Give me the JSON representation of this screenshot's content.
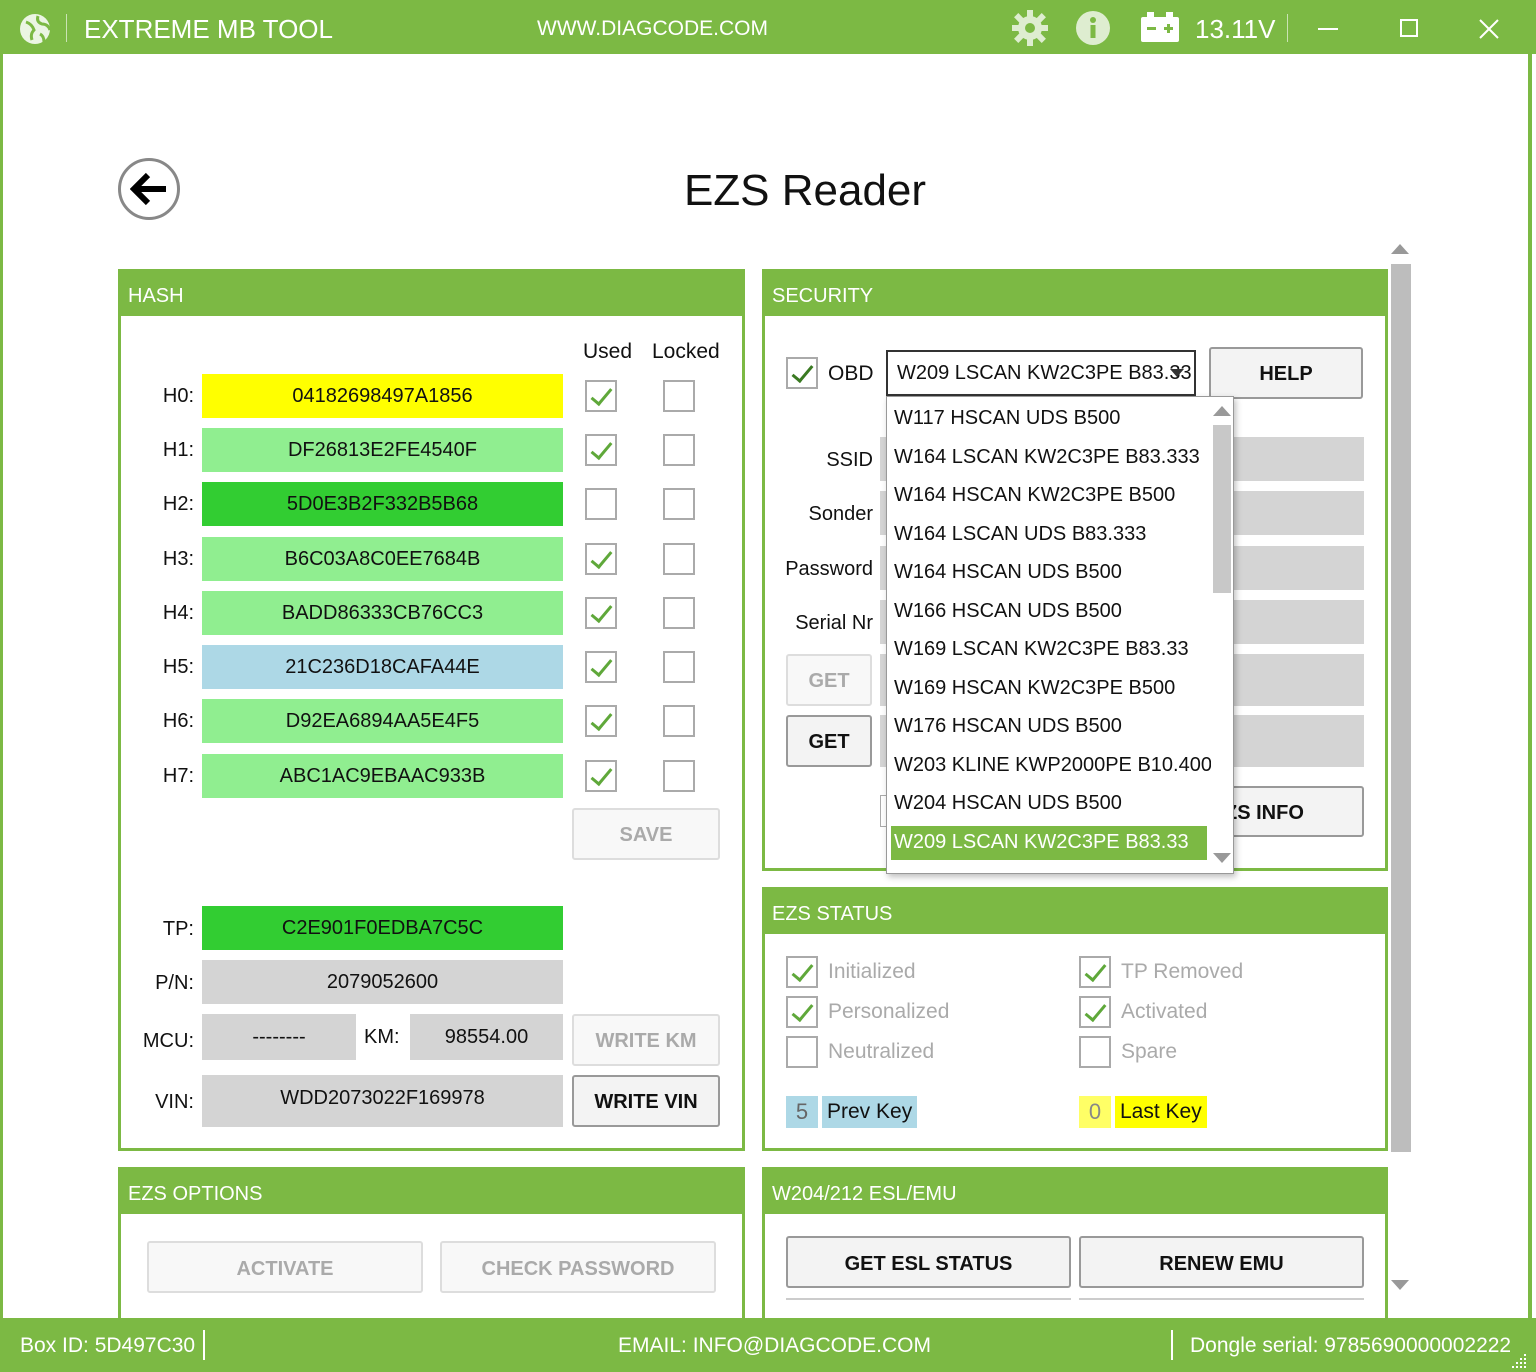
{
  "titlebar": {
    "app_name": "EXTREME MB TOOL",
    "url": "WWW.DIAGCODE.COM",
    "voltage": "13.11V",
    "icons": [
      "globe-icon",
      "gear-icon",
      "info-icon",
      "battery-icon",
      "minimize-icon",
      "maximize-icon",
      "close-icon"
    ]
  },
  "page": {
    "title": "EZS Reader"
  },
  "hash": {
    "header": "HASH",
    "col_used": "Used",
    "col_locked": "Locked",
    "rows": [
      {
        "label": "H0:",
        "value": "04182698497A1856",
        "color": "#ffff00",
        "used": true,
        "locked": false
      },
      {
        "label": "H1:",
        "value": "DF26813E2FE4540F",
        "color": "#90ee90",
        "used": true,
        "locked": false
      },
      {
        "label": "H2:",
        "value": "5D0E3B2F332B5B68",
        "color": "#32cd32",
        "used": false,
        "locked": false
      },
      {
        "label": "H3:",
        "value": "B6C03A8C0EE7684B",
        "color": "#90ee90",
        "used": true,
        "locked": false
      },
      {
        "label": "H4:",
        "value": "BADD86333CB76CC3",
        "color": "#90ee90",
        "used": true,
        "locked": false
      },
      {
        "label": "H5:",
        "value": "21C236D18CAFA44E",
        "color": "#add8e6",
        "used": true,
        "locked": false
      },
      {
        "label": "H6:",
        "value": "D92EA6894AA5E4F5",
        "color": "#90ee90",
        "used": true,
        "locked": false
      },
      {
        "label": "H7:",
        "value": "ABC1AC9EBAAC933B",
        "color": "#90ee90",
        "used": true,
        "locked": false
      }
    ],
    "save_label": "SAVE",
    "tp_label": "TP:",
    "tp_value": "C2E901F0EDBA7C5C",
    "pn_label": "P/N:",
    "pn_value": "2079052600",
    "mcu_label": "MCU:",
    "mcu_value": "--------",
    "km_label": "KM:",
    "km_value": "98554.00",
    "write_km_label": "WRITE KM",
    "vin_label": "VIN:",
    "vin_value": "WDD2073022F169978",
    "write_vin_label": "WRITE VIN"
  },
  "security": {
    "header": "SECURITY",
    "obd_label": "OBD",
    "obd_checked": true,
    "combo_value": "W209 LSCAN KW2C3PE B83.33",
    "help_label": "HELP",
    "ssid_label": "SSID",
    "sonder_label": "Sonder",
    "password_label": "Password",
    "serial_label": "Serial Nr",
    "get1_label": "GET",
    "get2_label": "GET",
    "ezs_info_label": "ZS INFO",
    "dropdown_options": [
      "W117 HSCAN UDS B500",
      "W164 LSCAN KW2C3PE B83.333",
      "W164 HSCAN KW2C3PE B500",
      "W164 LSCAN UDS B83.333",
      "W164 HSCAN UDS B500",
      "W166 HSCAN UDS B500",
      "W169 LSCAN KW2C3PE B83.33",
      "W169 HSCAN KW2C3PE B500",
      "W176 HSCAN UDS B500",
      "W203 KLINE KWP2000PE B10.400",
      "W204 HSCAN UDS B500",
      "W209 LSCAN KW2C3PE B83.33"
    ],
    "selected_index": 11
  },
  "ezs_status": {
    "header": "EZS STATUS",
    "items": [
      {
        "label": "Initialized",
        "checked": true
      },
      {
        "label": "TP Removed",
        "checked": true
      },
      {
        "label": "Personalized",
        "checked": true
      },
      {
        "label": "Activated",
        "checked": true
      },
      {
        "label": "Neutralized",
        "checked": false
      },
      {
        "label": "Spare",
        "checked": false
      }
    ],
    "prev_key_value": "5",
    "prev_key_label": "Prev Key",
    "last_key_value": "0",
    "last_key_label": "Last Key"
  },
  "ezs_options": {
    "header": "EZS OPTIONS",
    "activate_label": "ACTIVATE",
    "check_password_label": "CHECK PASSWORD"
  },
  "esl": {
    "header": "W204/212 ESL/EMU",
    "get_status_label": "GET ESL STATUS",
    "renew_label": "RENEW EMU"
  },
  "statusbar": {
    "box_id": "Box ID: 5D497C30",
    "email": "EMAIL: INFO@DIAGCODE.COM",
    "dongle": "Dongle serial: 9785690000002222"
  }
}
